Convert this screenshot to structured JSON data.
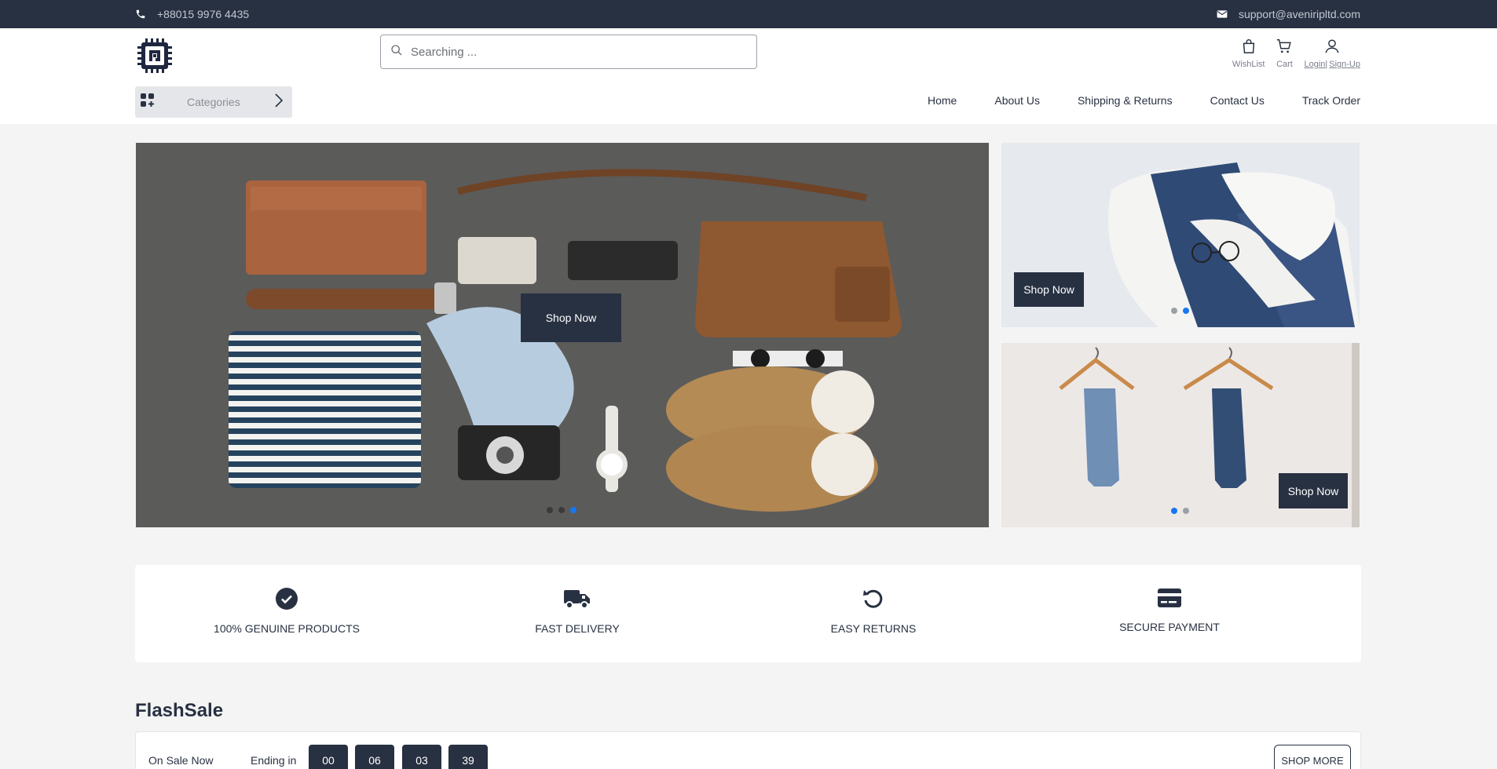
{
  "topbar": {
    "phone": "+88015 9976 4435",
    "email": "support@aveniripltd.com"
  },
  "header": {
    "search_placeholder": "Searching ...",
    "wishlist_label": "WishList",
    "cart_label": "Cart",
    "login_label": "Login|",
    "signup_label": "Sign-Up",
    "categories_label": "Categories"
  },
  "nav": {
    "items": [
      "Home",
      "About Us",
      "Shipping & Returns",
      "Contact Us",
      "Track Order"
    ]
  },
  "hero": {
    "main_button": "Shop Now",
    "side1_button": "Shop Now",
    "side2_button": "Shop Now",
    "main_active_dot": 3,
    "side1_active_dot": 2,
    "side2_active_dot": 1
  },
  "features": [
    {
      "label": "100% GENUINE PRODUCTS",
      "icon": "check-circle-icon"
    },
    {
      "label": "FAST DELIVERY",
      "icon": "truck-icon"
    },
    {
      "label": "EASY RETURNS",
      "icon": "rotate-ccw-icon"
    },
    {
      "label": "SECURE PAYMENT",
      "icon": "credit-card-icon"
    }
  ],
  "flash_sale": {
    "title": "FlashSale",
    "on_sale_label": "On Sale Now",
    "ending_label": "Ending in",
    "timer": [
      "00",
      "06",
      "03",
      "39"
    ],
    "shop_more_label": "SHOP MORE"
  },
  "colors": {
    "primary": "#283142",
    "accent_dot": "#1877f2",
    "page_bg": "#f4f4f4"
  }
}
